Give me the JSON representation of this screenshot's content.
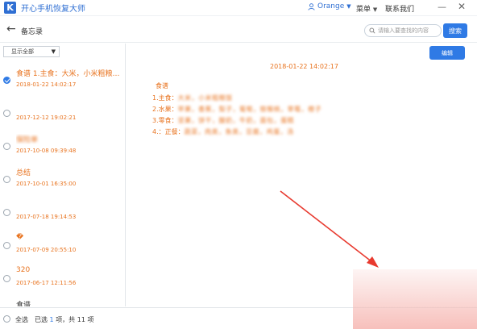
{
  "titlebar": {
    "logo_letter": "K",
    "app_title": "开心手机恢复大师",
    "user_name": "Orange",
    "menu_label": "菜单",
    "contact_label": "联系我们",
    "minimize_glyph": "—",
    "close_glyph": "✕"
  },
  "header": {
    "back_glyph": "←",
    "page_title": "备忘录",
    "search_placeholder": "请输入要查找的内容",
    "search_button": "搜索"
  },
  "sidebar": {
    "filter_value": "显示全部",
    "notes": [
      {
        "title": "食谱 1.主食：大米，小米粗粮饭...",
        "date": "2018-01-22 14:02:17",
        "checked": true,
        "title_blurred": false,
        "title_color": "orange"
      },
      {
        "title": "",
        "date": "2017-12-12 19:02:21",
        "checked": false,
        "title_blurred": false,
        "title_color": "orange"
      },
      {
        "title": "保险单",
        "date": "2017-10-08 09:39:48",
        "checked": false,
        "title_blurred": true,
        "title_color": "orange"
      },
      {
        "title": "总结",
        "date": "2017-10-01 16:35:00",
        "checked": false,
        "title_blurred": false,
        "title_color": "orange"
      },
      {
        "title": "",
        "date": "2017-07-18 19:14:53",
        "checked": false,
        "title_blurred": false,
        "title_color": "orange"
      },
      {
        "title": "�",
        "date": "2017-07-09 20:55:10",
        "checked": false,
        "title_blurred": false,
        "title_color": "orange"
      },
      {
        "title": "320",
        "date": "2017-06-17 12:11:56",
        "checked": false,
        "title_blurred": false,
        "title_color": "orange"
      },
      {
        "title": "食谱",
        "date": "",
        "checked": false,
        "title_blurred": false,
        "title_color": "dark"
      }
    ]
  },
  "detail": {
    "edit_button": "编辑",
    "date": "2018-01-22 14:02:17",
    "heading": "食谱",
    "lines": [
      {
        "prefix": "1.主食：",
        "blurred": "大米，小米粗粮饭"
      },
      {
        "prefix": "2.水果：",
        "blurred": "苹果，香蕉，梨子，葡萄，猕猴桃，草莓，橙子"
      },
      {
        "prefix": "3.零食：",
        "blurred": "坚果，饼干，酸奶，牛奶，面包，蛋糕"
      },
      {
        "prefix": "4.：正餐：",
        "blurred": "蔬菜，肉类，鱼类，豆腐，鸡蛋，汤"
      }
    ]
  },
  "footer": {
    "select_all": "全选",
    "status_prefix": "已选",
    "selected_count": "1",
    "status_middle": "项，共",
    "total_count": "11",
    "status_suffix": "项"
  },
  "colors": {
    "accent": "#2f7ae5",
    "note_text": "#e8731f",
    "annotation_arrow": "#e83a2f"
  }
}
